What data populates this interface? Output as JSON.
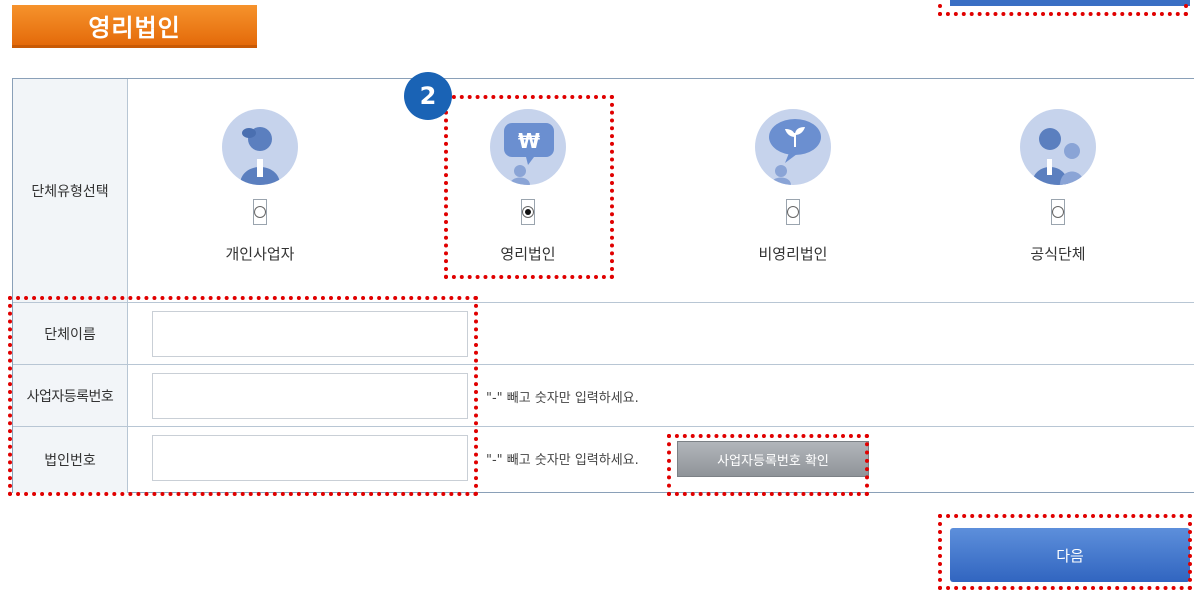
{
  "header": {
    "title": "영리법인"
  },
  "step_badge": "2",
  "type_row": {
    "label": "단체유형선택",
    "options": [
      {
        "label": "개인사업자",
        "icon": "person-icon",
        "checked": false
      },
      {
        "label": "영리법인",
        "icon": "won-speech-person-icon",
        "checked": true
      },
      {
        "label": "비영리법인",
        "icon": "sprout-speech-person-icon",
        "checked": false
      },
      {
        "label": "공식단체",
        "icon": "group-people-icon",
        "checked": false
      }
    ]
  },
  "fields": {
    "org_name": {
      "label": "단체이름",
      "value": ""
    },
    "biz_number": {
      "label": "사업자등록번호",
      "value": "",
      "hint": "\"-\" 빼고 숫자만 입력하세요."
    },
    "corp_number": {
      "label": "법인번호",
      "value": "",
      "hint": "\"-\" 빼고 숫자만 입력하세요."
    }
  },
  "verify_button": {
    "label": "사업자등록번호 확인"
  },
  "next_button": {
    "label": "다음"
  },
  "colors": {
    "accent": "#3165c0",
    "header_orange": "#f08020",
    "highlight": "#e00000",
    "badge": "#1a63b5"
  }
}
